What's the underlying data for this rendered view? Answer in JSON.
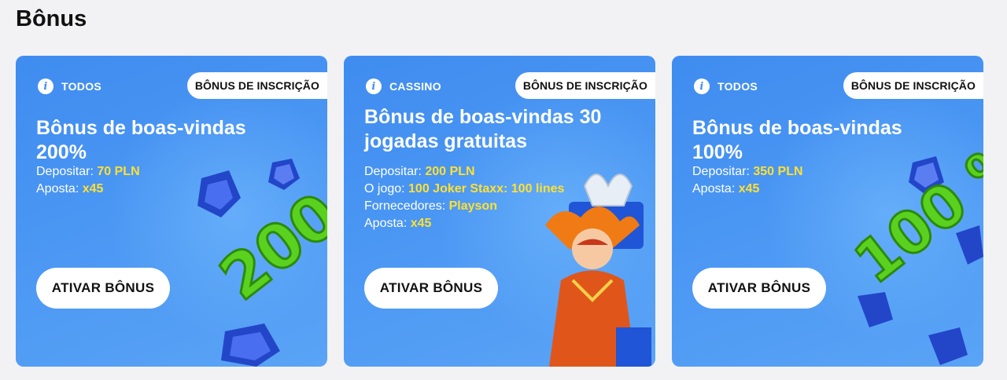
{
  "page": {
    "title": "Bônus"
  },
  "cards": [
    {
      "category": "TODOS",
      "tag": "BÔNUS DE INSCRIÇÃO",
      "title": "Bônus de boas-vindas 200%",
      "rows": [
        {
          "label": "Depositar: ",
          "value": "70 PLN"
        },
        {
          "label": "Aposta: ",
          "value": "x45"
        }
      ],
      "button": "ATIVAR BÔNUS",
      "art_text": "200 %"
    },
    {
      "category": "CASSINO",
      "tag": "BÔNUS DE INSCRIÇÃO",
      "title": "Bônus de boas-vindas 30 jogadas gratuitas",
      "rows": [
        {
          "label": "Depositar: ",
          "value": "200 PLN"
        },
        {
          "label": "O jogo: ",
          "value": "100 Joker Staxx: 100 lines"
        },
        {
          "label": "Fornecedores: ",
          "value": "Playson"
        },
        {
          "label": "Aposta: ",
          "value": "x45"
        }
      ],
      "button": "ATIVAR BÔNUS"
    },
    {
      "category": "TODOS",
      "tag": "BÔNUS DE INSCRIÇÃO",
      "title": "Bônus de boas-vindas 100%",
      "rows": [
        {
          "label": "Depositar: ",
          "value": "350 PLN"
        },
        {
          "label": "Aposta: ",
          "value": "x45"
        }
      ],
      "button": "ATIVAR BÔNUS",
      "art_text": "100 %"
    }
  ],
  "colors": {
    "card": "#4a96f3",
    "highlight": "#ffe033",
    "green": "#5ad11f",
    "gem": "#2346c9"
  },
  "icons": {
    "info": "info-icon"
  }
}
